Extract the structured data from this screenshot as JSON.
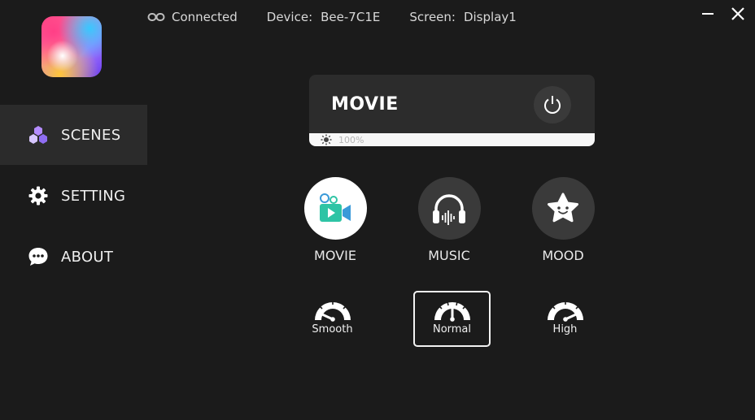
{
  "status": {
    "connection": "Connected",
    "device_label": "Device:",
    "device_value": "Bee-7C1E",
    "screen_label": "Screen:",
    "screen_value": "Display1"
  },
  "sidebar": {
    "items": [
      {
        "label": "SCENES",
        "icon": "scenes-icon",
        "active": true
      },
      {
        "label": "SETTING",
        "icon": "gear-icon",
        "active": false
      },
      {
        "label": "ABOUT",
        "icon": "chat-bubble-icon",
        "active": false
      }
    ]
  },
  "scene_card": {
    "title": "MOVIE",
    "brightness": "100%"
  },
  "modes": [
    {
      "label": "MOVIE",
      "icon": "movie-camera-icon",
      "active": true
    },
    {
      "label": "MUSIC",
      "icon": "headphones-icon",
      "active": false
    },
    {
      "label": "MOOD",
      "icon": "star-face-icon",
      "active": false
    }
  ],
  "speeds": [
    {
      "label": "Smooth",
      "icon": "gauge-low-icon",
      "active": false
    },
    {
      "label": "Normal",
      "icon": "gauge-mid-icon",
      "active": true
    },
    {
      "label": "High",
      "icon": "gauge-high-icon",
      "active": false
    }
  ],
  "colors": {
    "background": "#1b1b1b",
    "panel": "#2c2c2c",
    "accent_teal": "#2ec4a5",
    "accent_blue": "#3a9ad9"
  }
}
